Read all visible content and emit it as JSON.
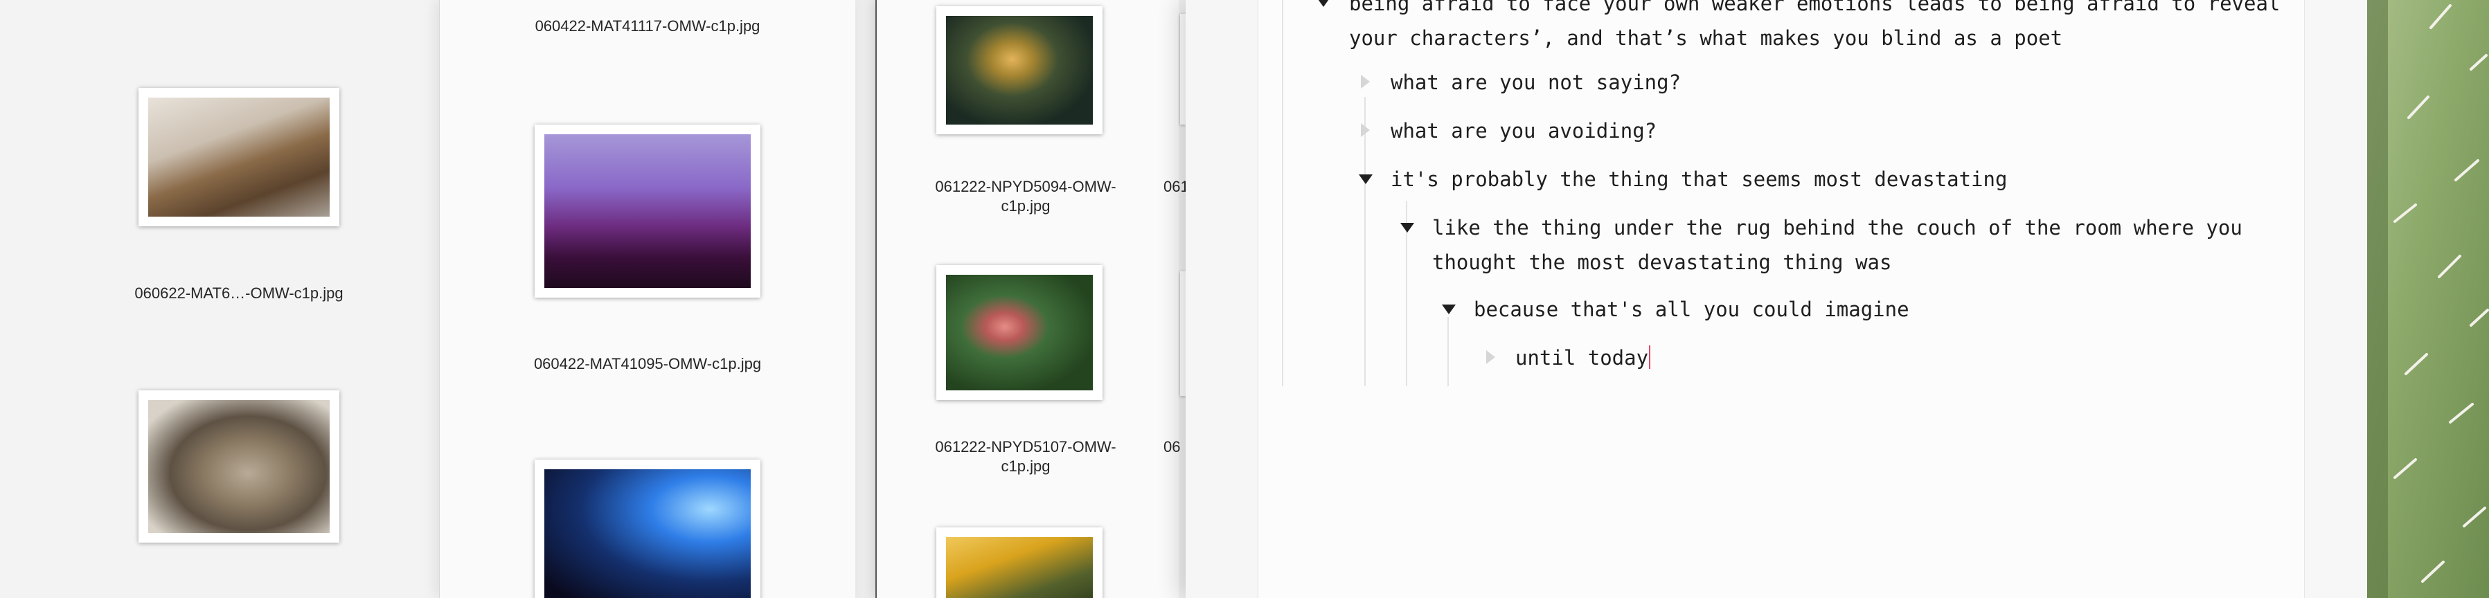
{
  "finder_left": {
    "captions": [
      "060622-MAT6…-OMW-c1p.jpg"
    ]
  },
  "finder_mid": {
    "captions": [
      "060422-MAT41117-OMW-c1p.jpg",
      "060422-MAT41095-OMW-c1p.jpg"
    ]
  },
  "finder_right": {
    "captions": [
      {
        "line1": "061222-NPYD5094-OMW-",
        "line2": "c1p.jpg"
      },
      {
        "line1": "061222-NPYD5107-OMW-",
        "line2": "c1p.jpg"
      }
    ],
    "cut_labels": [
      "061",
      "06"
    ]
  },
  "outline": {
    "items": [
      {
        "line1": "being afraid to face your own weaker emotions leads to being afraid to reveal",
        "line2": "your characters’, and that’s what makes you blind as a poet"
      },
      {
        "text": "what are you not saying?"
      },
      {
        "text": "what are you avoiding?"
      },
      {
        "text": "it's probably the thing that seems most devastating"
      },
      {
        "line1": "like the thing under the rug behind the couch of the room where you",
        "line2": "thought the most devastating thing was"
      },
      {
        "text": "because that's all you could imagine"
      },
      {
        "text": "until today"
      }
    ]
  },
  "colors": {
    "caret": "#e04a6a",
    "pane_bg": "#fafafa",
    "accent_green": "#7a9b5a"
  }
}
